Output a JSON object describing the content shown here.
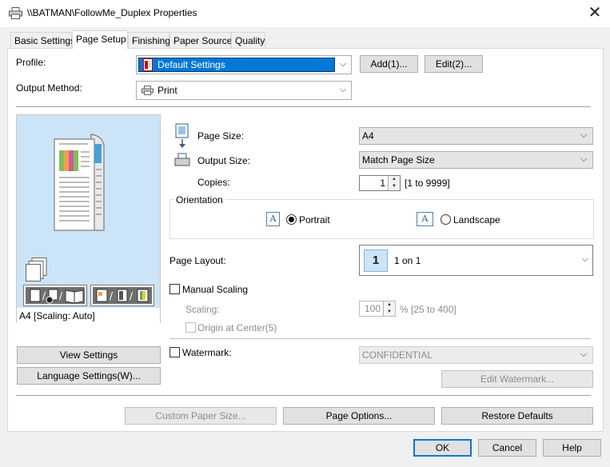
{
  "window": {
    "title": "\\\\BATMAN\\FollowMe_Duplex Properties"
  },
  "tabs": [
    {
      "label": "Basic Settings"
    },
    {
      "label": "Page Setup"
    },
    {
      "label": "Finishing"
    },
    {
      "label": "Paper Source"
    },
    {
      "label": "Quality"
    }
  ],
  "profile": {
    "label": "Profile:",
    "value": "Default Settings",
    "add_label": "Add(1)...",
    "edit_label": "Edit(2)..."
  },
  "output_method": {
    "label": "Output Method:",
    "value": "Print"
  },
  "preview": {
    "caption": "A4 [Scaling: Auto]"
  },
  "page_size": {
    "label": "Page Size:",
    "value": "A4"
  },
  "output_size": {
    "label": "Output Size:",
    "value": "Match Page Size"
  },
  "copies": {
    "label": "Copies:",
    "value": "1",
    "range": "[1 to 9999]"
  },
  "orientation": {
    "title": "Orientation",
    "portrait_label": "Portrait",
    "landscape_label": "Landscape",
    "selected": "Portrait",
    "icon_letter": "A"
  },
  "page_layout": {
    "label": "Page Layout:",
    "number": "1",
    "value": "1 on 1"
  },
  "manual_scaling": {
    "label": "Manual Scaling",
    "checked": false,
    "scaling_label": "Scaling:",
    "scaling_value": "100",
    "scaling_range": "% [25 to 400]",
    "origin_label": "Origin at Center(5)"
  },
  "watermark": {
    "label": "Watermark:",
    "checked": false,
    "value": "CONFIDENTIAL",
    "edit_label": "Edit Watermark..."
  },
  "left_buttons": {
    "view_settings": "View Settings",
    "language_settings": "Language Settings(W)..."
  },
  "bottom_buttons": {
    "custom_paper_size": "Custom Paper Size...",
    "page_options": "Page Options...",
    "restore_defaults": "Restore Defaults"
  },
  "dialog_buttons": {
    "ok": "OK",
    "cancel": "Cancel",
    "help": "Help"
  },
  "colors": {
    "accent": "#0078d7",
    "selection": "#0078d7",
    "preview_bg": "#cce4f7"
  }
}
